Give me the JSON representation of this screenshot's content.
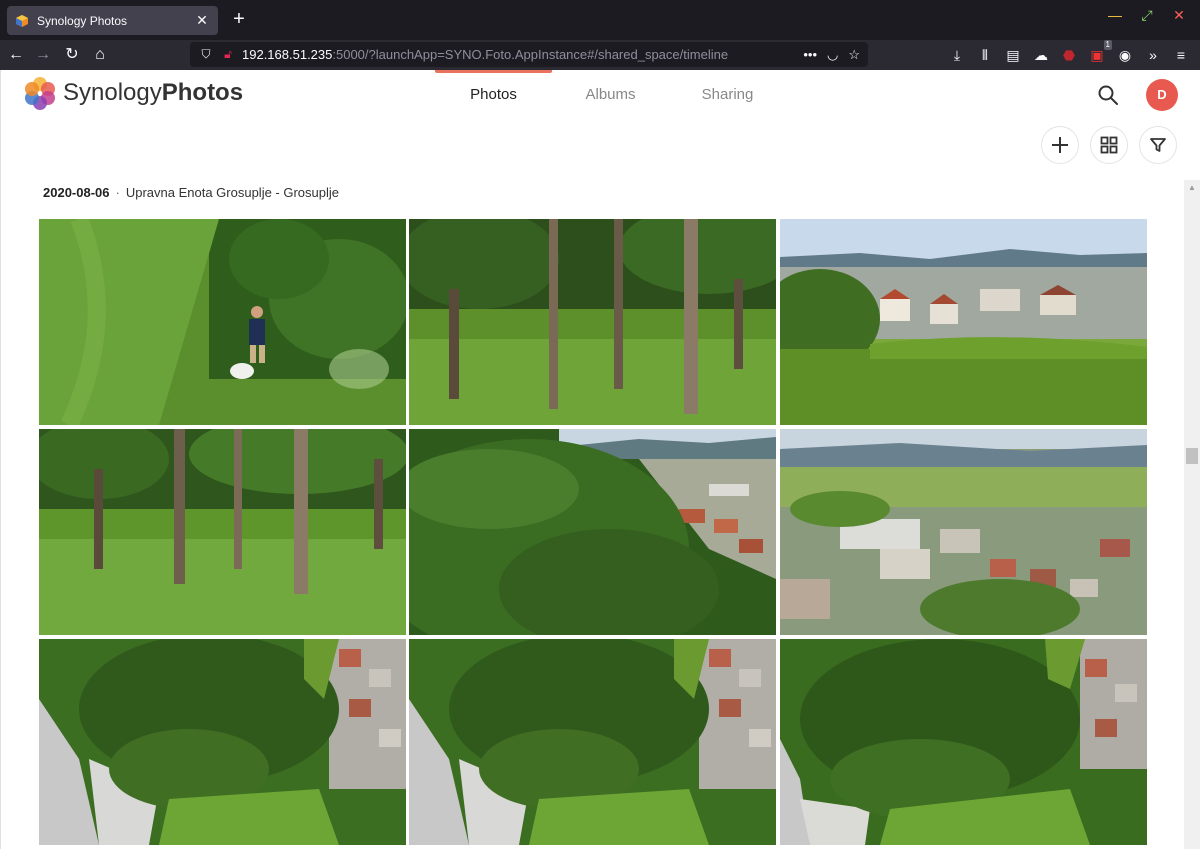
{
  "browser": {
    "tab_title": "Synology Photos",
    "url_host": "192.168.51.235",
    "url_rest": ":5000/?launchApp=SYNO.Foto.AppInstance#/shared_space/timeline",
    "badge_count": "1"
  },
  "app": {
    "logo_part1": "Synology",
    "logo_part2": "Photos",
    "tabs": [
      {
        "label": "Photos"
      },
      {
        "label": "Albums"
      },
      {
        "label": "Sharing"
      }
    ],
    "avatar_initial": "D",
    "accent_color": "#e9725e"
  },
  "timeline": {
    "date": "2020-08-06",
    "separator": "·",
    "location": "Upravna Enota Grosuplje - Grosuplje"
  },
  "photos": [
    {
      "scene": "grass-person-dog"
    },
    {
      "scene": "forest-trunks"
    },
    {
      "scene": "town-panorama"
    },
    {
      "scene": "forest-trunks-2"
    },
    {
      "scene": "aerial-forest-town"
    },
    {
      "scene": "aerial-town"
    },
    {
      "scene": "aerial-topdown-1"
    },
    {
      "scene": "aerial-topdown-2"
    },
    {
      "scene": "aerial-topdown-3"
    }
  ]
}
